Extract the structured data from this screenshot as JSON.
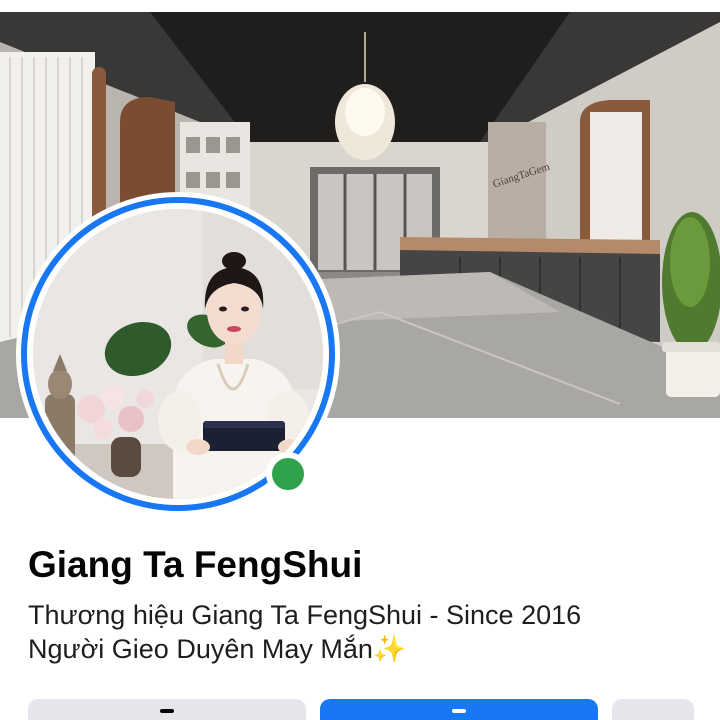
{
  "profile": {
    "name": "Giang Ta FengShui",
    "bio_line_1": "Thương hiệu Giang Ta FengShui - Since 2016",
    "bio_line_2": "Người Gieo Duyên May Mắn",
    "bio_emoji": "✨",
    "online": true
  },
  "cover": {
    "wall_sign": "GiangTaGem"
  },
  "colors": {
    "accent": "#1877f2",
    "online": "#31a24c",
    "secondary_button": "#e4e6eb"
  },
  "icons": {
    "online_status": "online-dot-icon",
    "sparkles": "sparkles-icon"
  }
}
